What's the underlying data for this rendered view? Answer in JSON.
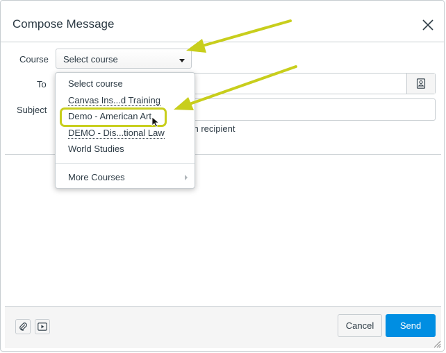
{
  "dialog": {
    "title": "Compose Message"
  },
  "form": {
    "course_label": "Course",
    "to_label": "To",
    "subject_label": "Subject",
    "course_value": "Select course",
    "recipient_note_fragment": "ch recipient"
  },
  "dropdown": {
    "items": [
      "Select course",
      "Canvas Ins...d Training",
      "Demo - American Art",
      "DEMO - Dis...tional Law",
      "World Studies"
    ],
    "more_label": "More Courses"
  },
  "footer": {
    "cancel_label": "Cancel",
    "send_label": "Send"
  },
  "colors": {
    "accent": "#008ee2",
    "annotation": "#c8ce1c"
  },
  "icons": [
    "close-icon",
    "caret-down-icon",
    "address-book-icon",
    "paperclip-icon",
    "media-icon",
    "resize-icon",
    "chevron-right-icon",
    "cursor-icon"
  ]
}
